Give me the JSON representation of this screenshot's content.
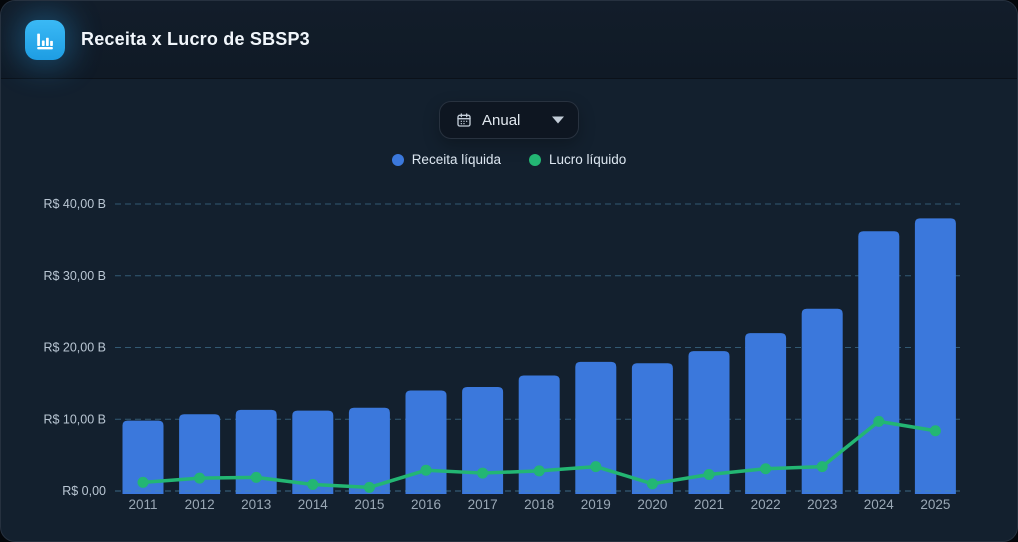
{
  "header": {
    "title": "Receita x Lucro de SBSP3"
  },
  "toolbar": {
    "period_selector": {
      "value": "Anual",
      "icon": "calendar-icon",
      "caret": "chevron-down-icon"
    }
  },
  "legend": [
    {
      "label": "Receita líquida",
      "color": "#3b78dc"
    },
    {
      "label": "Lucro líquido",
      "color": "#23b673"
    }
  ],
  "chart_data": {
    "type": "bar",
    "title": "Receita x Lucro de SBSP3",
    "categories": [
      "2011",
      "2012",
      "2013",
      "2014",
      "2015",
      "2016",
      "2017",
      "2018",
      "2019",
      "2020",
      "2021",
      "2022",
      "2023",
      "2024",
      "2025"
    ],
    "series": [
      {
        "name": "Receita líquida",
        "type": "bar",
        "color": "#3b78dc",
        "unit": "R$ B",
        "values": [
          9.8,
          10.7,
          11.3,
          11.2,
          11.6,
          14.0,
          14.5,
          16.1,
          18.0,
          17.8,
          19.5,
          22.0,
          25.4,
          36.2,
          38.0
        ]
      },
      {
        "name": "Lucro líquido",
        "type": "line",
        "color": "#23b673",
        "unit": "R$ B",
        "values": [
          1.2,
          1.8,
          1.9,
          0.9,
          0.5,
          2.9,
          2.5,
          2.8,
          3.4,
          1.0,
          2.3,
          3.1,
          3.4,
          9.7,
          8.4
        ]
      }
    ],
    "xlabel": "",
    "ylabel": "",
    "ylim": [
      0,
      40
    ],
    "y_axis": {
      "ticks": [
        {
          "label": "R$ 40,00 B",
          "value": 40
        },
        {
          "label": "R$ 30,00 B",
          "value": 30
        },
        {
          "label": "R$ 20,00 B",
          "value": 20
        },
        {
          "label": "R$ 10,00 B",
          "value": 10
        },
        {
          "label": "R$ 0,00",
          "value": 0
        }
      ]
    },
    "grid": "horizontal-dashed",
    "legend_position": "top-center"
  },
  "colors": {
    "panel_bg": "#13202e",
    "header_bg": "#111c28",
    "bar": "#3b78dc",
    "line": "#23b673",
    "gridline": "#4d89ad",
    "accent_icon": "#2bacee"
  }
}
